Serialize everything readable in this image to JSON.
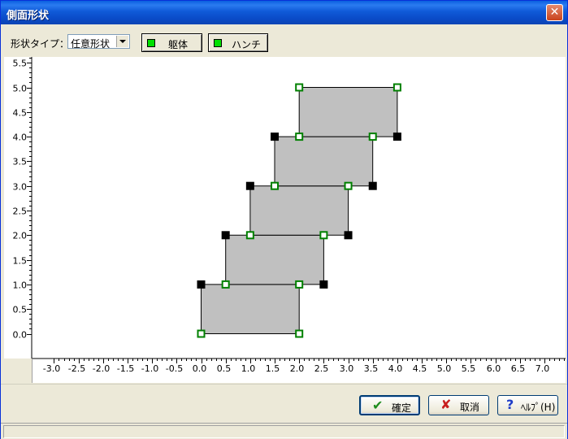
{
  "window": {
    "title": "側面形状",
    "close_glyph": "✕"
  },
  "toolbar": {
    "shape_type_label": "形状タイプ：",
    "shape_type_value": "任意形状",
    "body_button": "躯体",
    "haunch_button": "ハンチ"
  },
  "buttons": {
    "ok": "確定",
    "cancel": "取消",
    "help": "ﾍﾙﾌﾟ(H)"
  },
  "icons": {
    "ok": "check-icon",
    "cancel": "x-icon",
    "help": "question-icon"
  },
  "colors": {
    "titlebar": "#0a5fe0",
    "shape_fill": "#c0c0c0",
    "open_node": "#008000",
    "solid_node": "#000000",
    "indicator": "#00e000"
  },
  "chart_data": {
    "type": "scatter",
    "title": "",
    "xlabel": "",
    "ylabel": "",
    "xlim": [
      -3.0,
      7.0
    ],
    "ylim": [
      0.0,
      5.5
    ],
    "x_ticks": [
      "-3.0",
      "-2.5",
      "-2.0",
      "-1.5",
      "-1.0",
      "-0.5",
      "0.0",
      "0.5",
      "1.0",
      "1.5",
      "2.0",
      "2.5",
      "3.0",
      "3.5",
      "4.0",
      "4.5",
      "5.0",
      "5.5",
      "6.0",
      "6.5",
      "7.0"
    ],
    "y_ticks": [
      "0.0",
      "0.5",
      "1.0",
      "1.5",
      "2.0",
      "2.5",
      "3.0",
      "3.5",
      "4.0",
      "4.5",
      "5.0",
      "5.5"
    ],
    "polygons": [
      [
        [
          0.0,
          0.0
        ],
        [
          2.0,
          0.0
        ],
        [
          2.0,
          1.0
        ],
        [
          0.0,
          1.0
        ]
      ],
      [
        [
          0.5,
          1.0
        ],
        [
          2.5,
          1.0
        ],
        [
          2.5,
          2.0
        ],
        [
          0.5,
          2.0
        ]
      ],
      [
        [
          1.0,
          2.0
        ],
        [
          3.0,
          2.0
        ],
        [
          3.0,
          3.0
        ],
        [
          1.0,
          3.0
        ]
      ],
      [
        [
          1.5,
          3.0
        ],
        [
          3.5,
          3.0
        ],
        [
          3.5,
          4.0
        ],
        [
          1.5,
          4.0
        ]
      ],
      [
        [
          2.0,
          4.0
        ],
        [
          4.0,
          4.0
        ],
        [
          4.0,
          5.0
        ],
        [
          2.0,
          5.0
        ]
      ]
    ],
    "open_nodes": [
      [
        0.0,
        0.0
      ],
      [
        2.0,
        0.0
      ],
      [
        0.5,
        1.0
      ],
      [
        2.0,
        1.0
      ],
      [
        1.0,
        2.0
      ],
      [
        2.5,
        2.0
      ],
      [
        1.5,
        3.0
      ],
      [
        3.0,
        3.0
      ],
      [
        2.0,
        4.0
      ],
      [
        3.5,
        4.0
      ],
      [
        2.0,
        5.0
      ],
      [
        4.0,
        5.0
      ]
    ],
    "solid_nodes": [
      [
        0.0,
        1.0
      ],
      [
        2.5,
        1.0
      ],
      [
        0.5,
        2.0
      ],
      [
        3.0,
        2.0
      ],
      [
        1.0,
        3.0
      ],
      [
        3.5,
        3.0
      ],
      [
        1.5,
        4.0
      ],
      [
        4.0,
        4.0
      ]
    ]
  }
}
